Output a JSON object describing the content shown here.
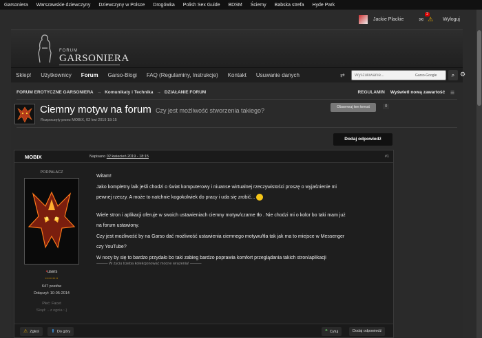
{
  "topbar": [
    "Garsoniera",
    "Warszawskie dziewczyny",
    "Dziewczyny w Polsce",
    "Drogówka",
    "Polish Sex Guide",
    "BDSM",
    "Ściemy",
    "Babska strefa",
    "Hyde Park"
  ],
  "userbar": {
    "username": "Jackie Plackie",
    "notif_count": "2",
    "logout": "Wyloguj"
  },
  "logo": {
    "small": "FORUM",
    "brand": "GARSONIERA"
  },
  "nav": {
    "items": [
      "Sklep!",
      "Użytkownicy",
      "Forum",
      "Garso-Blogi",
      "FAQ (Regulaminy, Instrukcje)",
      "Kontakt",
      "Usuwanie danych"
    ],
    "active_index": 2,
    "search_placeholder": "Wyszukiwanie...",
    "search_scope": "Garso-Google"
  },
  "breadcrumb": {
    "items": [
      "FORUM EROTYCZNE GARSONIERA",
      "Komunikaty i Technika",
      "DZIAŁANIE FORUM"
    ],
    "regulamin": "REGULAMIN",
    "new_content": "Wyświetl nową zawartość"
  },
  "topic": {
    "title": "Ciemny motyw na forum",
    "subtitle": "Czy jest możliwość stworzenia takiego?",
    "started_by": "Rozpoczęty przez MOBIX, 02 kwi 2019 18:15",
    "follow_label": "Obserwuj ten temat",
    "follow_count": "0",
    "reply_label": "Dodaj odpowiedź"
  },
  "post": {
    "author": "MOBIX",
    "posted_prefix": "Napisano",
    "posted_date": "02 kwiecień 2019 - 18:15",
    "number": "#1",
    "rank": "PODPALACZ",
    "group": "users",
    "pips": "••••••••••",
    "posts": "647 postów",
    "joined": "Dołączył: 10-05-2014",
    "sex": "Płeć: Facet",
    "skad": "Skąd: ...z ognia :-)",
    "body": {
      "l1": "Witam!",
      "l2": "Jako kompletny laik jeśli chodzi o świat komputerowy i niuanse wirtualnej rzeczywistości proszę o wyjaśnienie mi",
      "l3": "pewnej rzeczy. A może to natchnie kogokolwiek do pracy i uda się zrobić...",
      "l4": "Wiele stron i aplikacji oferuje w swoich ustawieniach ciemny motyw/czarne tło . Nie chodzi mi o kolor bo taki mam już",
      "l5": "na forum ustawiony.",
      "l6": "Czy jest możliwość by na Garso dać możliwość ustawienia ciemnego motywu/tła tak jak ma to miejsce w Messenger",
      "l7": "czy YouTube?",
      "l8": "W nocy by się to bardzo przydało bo taki zabieg bardzo poprawia komfort przeglądania takich stron/aplikacji"
    },
    "signature": "——— W życiu trzeba kolekcjonować mocne wrażenia! ———",
    "footer": {
      "report": "Zgłoś",
      "top": "Do góry",
      "quote": "Cytuj",
      "reply": "Dodaj odpowiedź"
    }
  }
}
